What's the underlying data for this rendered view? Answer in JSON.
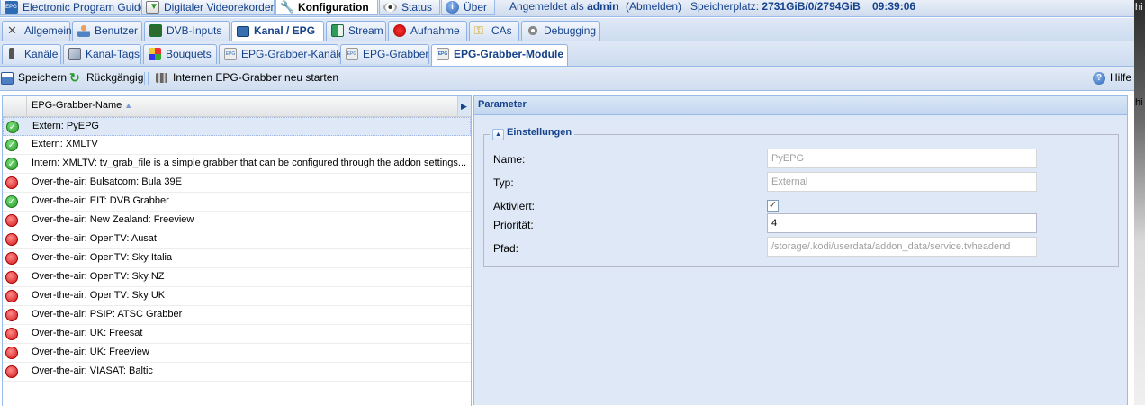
{
  "top_tabs": [
    {
      "label": "Electronic Program Guide",
      "icon": "epg-icon",
      "active": false
    },
    {
      "label": "Digitaler Videorekorder",
      "icon": "download-icon",
      "active": false
    },
    {
      "label": "Konfiguration",
      "icon": "wrench-icon",
      "active": true
    },
    {
      "label": "Status",
      "icon": "eye-icon",
      "active": false
    },
    {
      "label": "Über",
      "icon": "info-icon",
      "active": false
    }
  ],
  "user_info": {
    "logged_in_prefix": "Angemeldet als",
    "user": "admin",
    "logout_label": "(Abmelden)",
    "storage_label": "Speicherplatz:",
    "storage_value": "2731GiB/0/2794GiB",
    "time": "09:39:06"
  },
  "config_tabs": [
    {
      "label": "Allgemein",
      "icon": "tools-icon",
      "active": false
    },
    {
      "label": "Benutzer",
      "icon": "users-icon",
      "active": false
    },
    {
      "label": "DVB-Inputs",
      "icon": "dvb-icon",
      "active": false
    },
    {
      "label": "Kanal / EPG",
      "icon": "tv-icon",
      "active": true
    },
    {
      "label": "Stream",
      "icon": "stream-icon",
      "active": false
    },
    {
      "label": "Aufnahme",
      "icon": "record-icon",
      "active": false
    },
    {
      "label": "CAs",
      "icon": "key-icon",
      "active": false
    },
    {
      "label": "Debugging",
      "icon": "bug-icon",
      "active": false
    }
  ],
  "sub_tabs": [
    {
      "label": "Kanäle",
      "icon": "remote-icon",
      "active": false
    },
    {
      "label": "Kanal-Tags",
      "icon": "tag-icon",
      "active": false
    },
    {
      "label": "Bouquets",
      "icon": "grid-icon",
      "active": false
    },
    {
      "label": "EPG-Grabber-Kanäle",
      "icon": "grabber-icon",
      "active": false
    },
    {
      "label": "EPG-Grabber",
      "icon": "grabber-icon",
      "active": false
    },
    {
      "label": "EPG-Grabber-Module",
      "icon": "grabber-icon",
      "active": true
    }
  ],
  "toolbar": {
    "save_label": "Speichern",
    "undo_label": "Rückgängig",
    "restart_label": "Internen EPG-Grabber neu starten",
    "help_label": "Hilfe"
  },
  "grid": {
    "column_header": "EPG-Grabber-Name",
    "sort_indicator": "▲",
    "rows": [
      {
        "name": "Extern: PyEPG",
        "enabled": true,
        "selected": true
      },
      {
        "name": "Extern: XMLTV",
        "enabled": true,
        "selected": false
      },
      {
        "name": "Intern: XMLTV: tv_grab_file is a simple grabber that can be configured through the addon settings...",
        "enabled": true,
        "selected": false
      },
      {
        "name": "Over-the-air: Bulsatcom: Bula 39E",
        "enabled": false,
        "selected": false
      },
      {
        "name": "Over-the-air: EIT: DVB Grabber",
        "enabled": true,
        "selected": false
      },
      {
        "name": "Over-the-air: New Zealand: Freeview",
        "enabled": false,
        "selected": false
      },
      {
        "name": "Over-the-air: OpenTV: Ausat",
        "enabled": false,
        "selected": false
      },
      {
        "name": "Over-the-air: OpenTV: Sky Italia",
        "enabled": false,
        "selected": false
      },
      {
        "name": "Over-the-air: OpenTV: Sky NZ",
        "enabled": false,
        "selected": false
      },
      {
        "name": "Over-the-air: OpenTV: Sky UK",
        "enabled": false,
        "selected": false
      },
      {
        "name": "Over-the-air: PSIP: ATSC Grabber",
        "enabled": false,
        "selected": false
      },
      {
        "name": "Over-the-air: UK: Freesat",
        "enabled": false,
        "selected": false
      },
      {
        "name": "Over-the-air: UK: Freeview",
        "enabled": false,
        "selected": false
      },
      {
        "name": "Over-the-air: VIASAT: Baltic",
        "enabled": false,
        "selected": false
      }
    ]
  },
  "parameter_panel": {
    "title": "Parameter",
    "fieldset_title": "Einstellungen",
    "fields": {
      "name": {
        "label": "Name:",
        "value": "PyEPG"
      },
      "type": {
        "label": "Typ:",
        "value": "External"
      },
      "enabled": {
        "label": "Aktiviert:",
        "checked": true
      },
      "priority": {
        "label": "Priorität:",
        "value": "4"
      },
      "path": {
        "label": "Pfad:",
        "value": "/storage/.kodi/userdata/addon_data/service.tvheadend"
      }
    }
  },
  "edge_text": {
    "top": "hi",
    "middle": "hi"
  },
  "colors": {
    "accent": "#15428b",
    "border": "#99bbe8",
    "panel_bg": "#dfe8f6",
    "enabled": "#2b9a2b",
    "disabled": "#d01818"
  }
}
